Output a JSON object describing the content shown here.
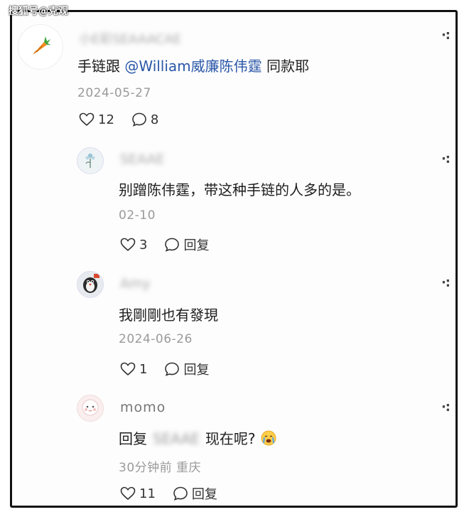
{
  "watermark": "搜狐号@克观",
  "comments": [
    {
      "username": "小E彩SEAAACAE",
      "content_prefix": "手链跟 ",
      "mention": "@William威廉陈伟霆",
      "content_suffix": " 同款耶",
      "time": "2024-05-27",
      "likes": "12",
      "replies": "8",
      "avatar_icon": "carrot-icon"
    },
    {
      "username": "SEAAE",
      "content": "别蹭陈伟霆，带这种手链的人多的是。",
      "time": "02-10",
      "likes": "3",
      "reply_label": "回复",
      "avatar_icon": "flower-icon"
    },
    {
      "username": "Amy",
      "content": "我剛剛也有發現",
      "time": "2024-06-26",
      "likes": "1",
      "reply_label": "回复",
      "avatar_icon": "penguin-icon"
    },
    {
      "username": "momo",
      "content_prefix": "回复",
      "mention": "SEAAE",
      "content_suffix": "现在呢?",
      "time": "30分钟前 重庆",
      "likes": "11",
      "reply_label": "回复",
      "avatar_icon": "cartoon-face-icon",
      "emoji": "crying-face-emoji"
    }
  ],
  "colors": {
    "mention": "#2a57a8",
    "secondary_text": "#9a9a9a",
    "border": "#111111"
  }
}
